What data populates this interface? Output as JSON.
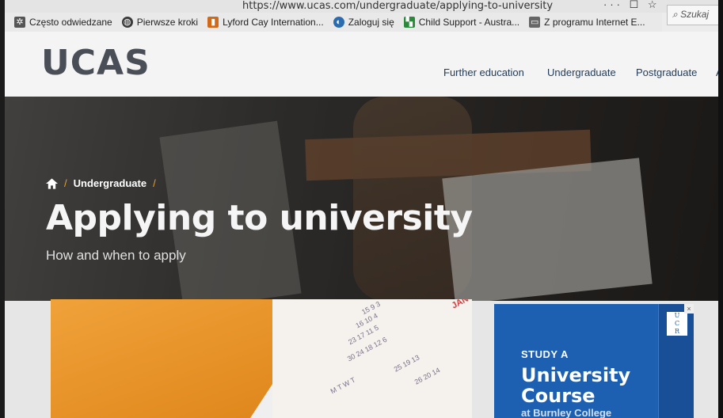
{
  "browser": {
    "url": "https://www.ucas.com/undergraduate/applying-to-university",
    "page_actions": "··· ☐ ☆",
    "search_placeholder": "Szukaj"
  },
  "bookmarks": [
    {
      "label": "Często odwiedzane",
      "icon": "gear-icon",
      "color": "#555555"
    },
    {
      "label": "Pierwsze kroki",
      "icon": "globe-icon",
      "color": "#3a3a3a"
    },
    {
      "label": "Lyford Cay Internation...",
      "icon": "bookmark-icon",
      "color": "#d06a1a"
    },
    {
      "label": "Zaloguj się",
      "icon": "swirl-icon",
      "color": "#2b6cb0"
    },
    {
      "label": "Child Support - Austra...",
      "icon": "flag-icon",
      "color": "#2a8a3a"
    },
    {
      "label": "Z programu Internet E...",
      "icon": "folder-icon",
      "color": "#666666"
    }
  ],
  "site": {
    "logo": "UCAS",
    "nav": [
      "Further education",
      "Undergraduate",
      "Postgraduate",
      "A"
    ]
  },
  "hero": {
    "breadcrumb": [
      "Undergraduate"
    ],
    "title": "Applying to university",
    "subtitle": "How and when to apply"
  },
  "ad": {
    "line1": "STUDY A",
    "line2": "University",
    "line3": "Course",
    "line4": "at Burnley College"
  },
  "colors": {
    "accent_orange": "#e8a030",
    "ucas_grey": "#4a4f57",
    "ad_blue": "#1d5fb0"
  }
}
